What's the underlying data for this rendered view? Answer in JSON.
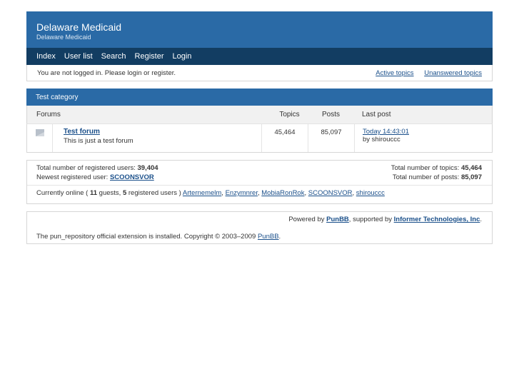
{
  "header": {
    "title": "Delaware Medicaid",
    "subtitle": "Delaware Medicaid"
  },
  "nav": [
    "Index",
    "User list",
    "Search",
    "Register",
    "Login"
  ],
  "status": {
    "text": "You are not logged in. Please login or register.",
    "active": "Active topics",
    "unanswered": "Unanswered topics"
  },
  "category": {
    "name": "Test category",
    "cols": {
      "forums": "Forums",
      "topics": "Topics",
      "posts": "Posts",
      "last": "Last post"
    },
    "forum": {
      "name": "Test forum",
      "desc": "This is just a test forum",
      "topics": "45,464",
      "posts": "85,097",
      "last_time": "Today 14:43:01",
      "last_by": "by shirouccc"
    }
  },
  "stats": {
    "reg_label": "Total number of registered users: ",
    "reg_val": "39,404",
    "newest_label": "Newest registered user: ",
    "newest_val": "SCOONSVOR",
    "topics_label": "Total number of topics: ",
    "topics_val": "45,464",
    "posts_label": "Total number of posts: ",
    "posts_val": "85,097",
    "online_pre": "Currently online ( ",
    "guests": "11",
    "guests_txt": " guests, ",
    "reg": "5",
    "reg_txt": " registered users ) ",
    "users": [
      "Arternemelm",
      "Enzymnrer",
      "MobiaRonRok",
      "SCOONSVOR",
      "shirouccс"
    ]
  },
  "footer": {
    "powered_pre": "Powered by ",
    "punbb": "PunBB",
    "supported": ", supported by ",
    "informer": "Informer Technologies, Inc",
    "copy": "The pun_repository official extension is installed. Copyright © 2003–2009 ",
    "copy_link": "PunBB",
    "dot": "."
  }
}
